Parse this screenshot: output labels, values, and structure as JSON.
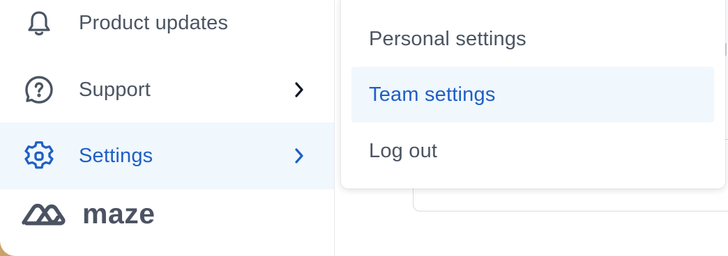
{
  "sidebar": {
    "items": [
      {
        "label": "Product updates",
        "icon": "bell-icon"
      },
      {
        "label": "Support",
        "icon": "help-circle-icon",
        "has_submenu": true
      },
      {
        "label": "Settings",
        "icon": "gear-icon",
        "has_submenu": true,
        "active": true
      }
    ]
  },
  "brand": {
    "name": "maze",
    "logo_icon": "maze-logo-icon"
  },
  "settings_menu": {
    "items": [
      {
        "label": "Personal settings"
      },
      {
        "label": "Team settings",
        "highlighted": true
      },
      {
        "label": "Log out"
      }
    ]
  },
  "colors": {
    "text": "#4b5563",
    "accent": "#1f5fc4",
    "highlight_bg": "#f0f7fd",
    "border": "#e6e7ea",
    "corner": "#c9a267"
  }
}
